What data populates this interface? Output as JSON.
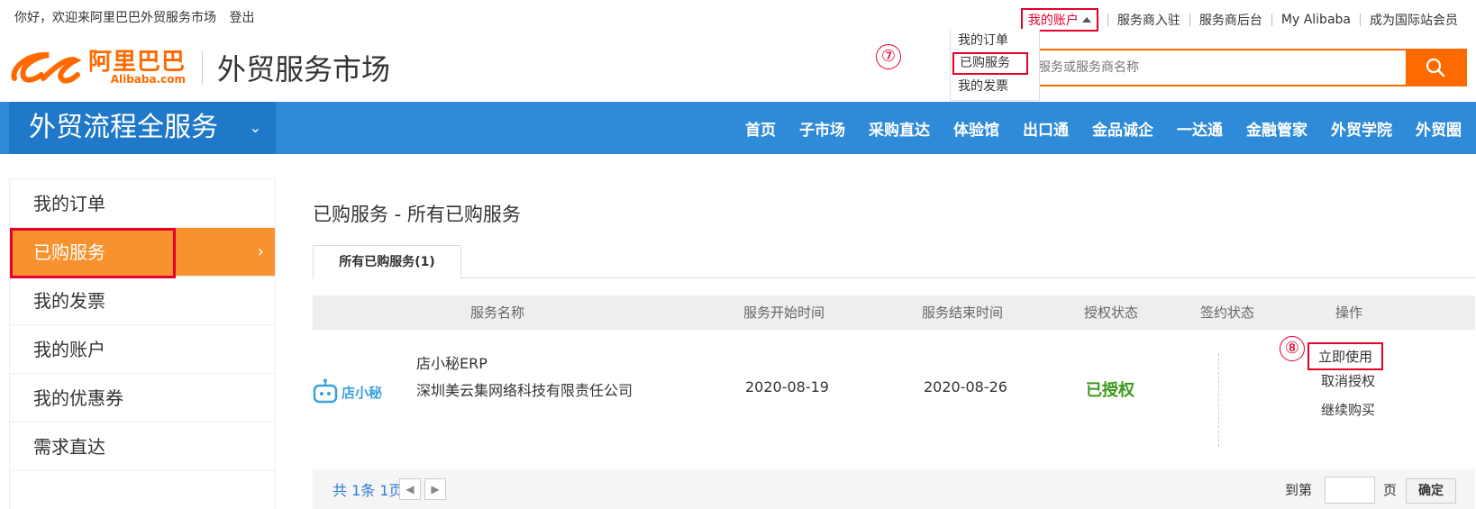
{
  "topbar": {
    "greeting": "你好，欢迎来阿里巴巴外贸服务市场",
    "logout": "登出",
    "account": "我的账户",
    "links": [
      "服务商入驻",
      "服务商后台",
      "My Alibaba",
      "成为国际站会员"
    ]
  },
  "dropdown": {
    "items": [
      "我的订单",
      "已购服务",
      "我的发票"
    ]
  },
  "markers": {
    "m7": "⑦",
    "m8": "⑧"
  },
  "logo": {
    "cn": "阿里巴巴",
    "en": "Alibaba.com",
    "title": "外贸服务市场"
  },
  "search": {
    "placeholder": "服务或服务商名称",
    "icon": "search-icon"
  },
  "nav": {
    "category": "外贸流程全服务",
    "items": [
      "首页",
      "子市场",
      "采购直达",
      "体验馆",
      "出口通",
      "金品诚企",
      "一达通",
      "金融管家",
      "外贸学院",
      "外贸圈"
    ]
  },
  "sidebar": {
    "items": [
      "我的订单",
      "已购服务",
      "我的发票",
      "我的账户",
      "我的优惠券",
      "需求直达"
    ],
    "active_index": 1
  },
  "main": {
    "title": "已购服务 - 所有已购服务",
    "tab": "所有已购服务(1)",
    "columns": [
      "服务名称",
      "服务开始时间",
      "服务结束时间",
      "授权状态",
      "签约状态",
      "操作"
    ],
    "row": {
      "logo_text": "店小秘",
      "service_name": "店小秘ERP",
      "company": "深圳美云集网络科技有限责任公司",
      "start": "2020-08-19",
      "end": "2020-08-26",
      "auth_status": "已授权",
      "actions": [
        "立即使用",
        "取消授权",
        "继续购买"
      ]
    },
    "pager": {
      "summary": "共 1条 1页",
      "goto_prefix": "到第",
      "goto_suffix": "页",
      "confirm": "确定"
    }
  },
  "colors": {
    "accent_orange": "#ff6a00",
    "nav_blue": "#2f8ad8",
    "highlight_red": "#e4002b",
    "auth_green": "#3a9a1a",
    "link_blue": "#2d7bd3"
  }
}
